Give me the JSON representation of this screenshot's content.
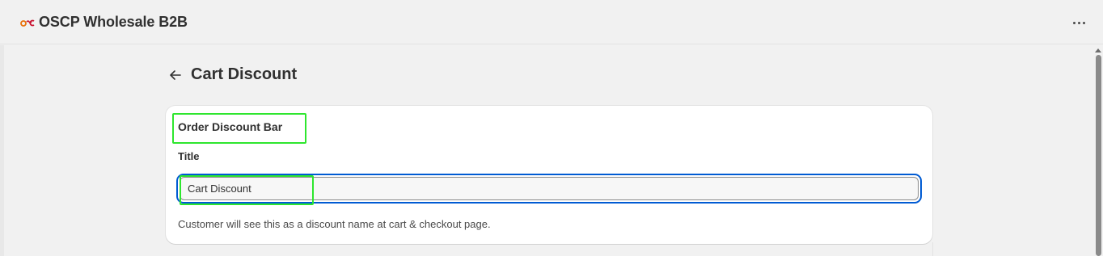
{
  "app": {
    "title": "OSCP Wholesale B2B",
    "logo_text": "osc"
  },
  "header": {
    "more_icon": "more-horizontal-icon"
  },
  "page": {
    "title": "Cart Discount",
    "back_icon": "arrow-left-icon"
  },
  "card": {
    "heading": "Order Discount Bar",
    "field": {
      "label": "Title",
      "value": "Cart Discount",
      "help_text": "Customer will see this as a discount name at cart & checkout page."
    }
  },
  "colors": {
    "accent_focus": "#005bd3",
    "highlight": "#2ee62e",
    "logo_orange": "#e8710a",
    "logo_red": "#c8102e"
  }
}
